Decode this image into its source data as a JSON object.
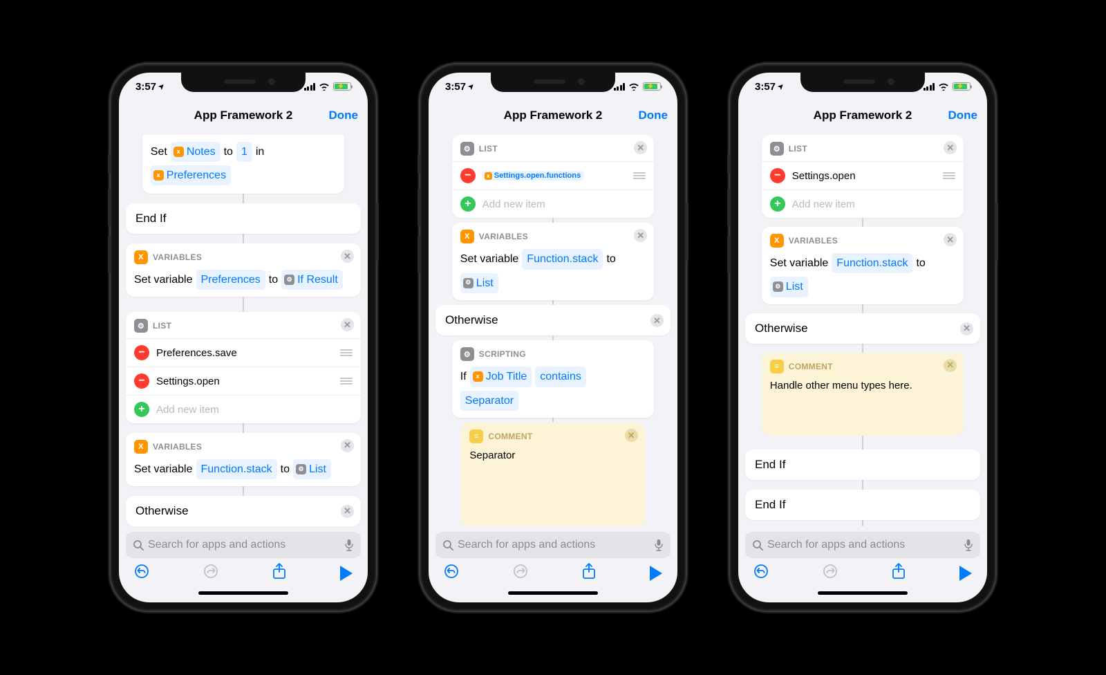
{
  "status": {
    "time": "3:57",
    "loc_arrow": "➤"
  },
  "nav": {
    "title": "App Framework 2",
    "done": "Done"
  },
  "search": {
    "placeholder": "Search for apps and actions"
  },
  "labels": {
    "variables": "VARIABLES",
    "list": "LIST",
    "scripting": "SCRIPTING",
    "comment": "COMMENT",
    "add_item": "Add new item",
    "set_variable": "Set variable",
    "set": "Set",
    "to": "to",
    "in": "in",
    "if": "If",
    "end_if": "End If",
    "otherwise": "Otherwise"
  },
  "phone1": {
    "setcard": {
      "var": "Notes",
      "val": "1",
      "dest": "Preferences"
    },
    "var1": {
      "name": "Preferences",
      "src": "If Result"
    },
    "list": {
      "items": [
        "Preferences.save",
        "Settings.open"
      ]
    },
    "var2": {
      "name": "Function.stack",
      "src": "List"
    }
  },
  "phone2": {
    "list": {
      "token": "Settings.open.functions"
    },
    "var": {
      "name": "Function.stack",
      "src": "List"
    },
    "ifcard": {
      "var": "Job Title",
      "op": "contains",
      "rhs": "Separator"
    },
    "comment": "Separator"
  },
  "phone3": {
    "list": {
      "item": "Settings.open"
    },
    "var": {
      "name": "Function.stack",
      "src": "List"
    },
    "comment": "Handle other menu types here."
  }
}
